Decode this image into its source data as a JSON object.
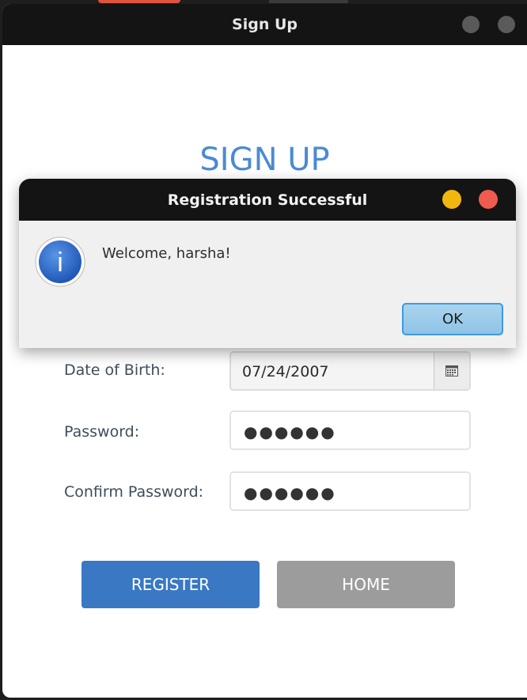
{
  "window": {
    "title": "Sign Up"
  },
  "form": {
    "heading": "SIGN UP",
    "dob_label": "Date of Birth:",
    "dob_value": "07/24/2007",
    "password_label": "Password:",
    "password_value": "●●●●●●",
    "confirm_label": "Confirm Password:",
    "confirm_value": "●●●●●●",
    "register_label": "REGISTER",
    "home_label": "HOME"
  },
  "dialog": {
    "title": "Registration Successful",
    "message": "Welcome, harsha!",
    "ok_label": "OK",
    "icon_letter": "i"
  },
  "colors": {
    "accent": "#3a78c4",
    "heading": "#4a8ad4",
    "home_button": "#9c9c9c",
    "dialog_minimize": "#f2b70f",
    "dialog_close": "#ef5b4f"
  }
}
